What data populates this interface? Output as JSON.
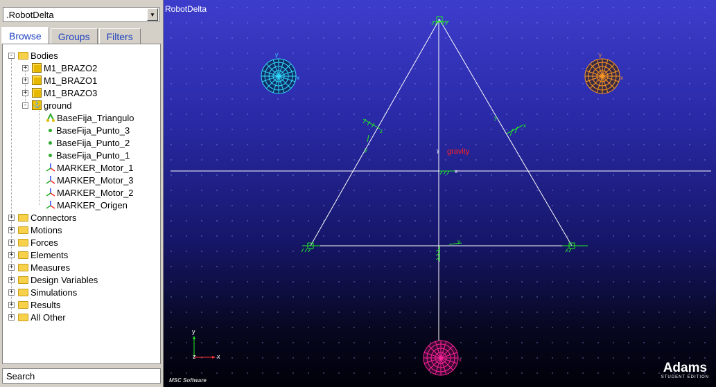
{
  "model_selector": {
    "value": ".RobotDelta"
  },
  "tabs": [
    {
      "label": "Browse",
      "active": true
    },
    {
      "label": "Groups",
      "active": false
    },
    {
      "label": "Filters",
      "active": false
    }
  ],
  "tree": {
    "bodies": {
      "label": "Bodies",
      "items": [
        "M1_BRAZO2",
        "M1_BRAZO1",
        "M1_BRAZO3"
      ],
      "ground": {
        "label": "ground",
        "children": [
          {
            "label": "BaseFija_Triangulo",
            "icon": "shape-icon"
          },
          {
            "label": "BaseFija_Punto_3",
            "icon": "point-icon"
          },
          {
            "label": "BaseFija_Punto_2",
            "icon": "point-icon"
          },
          {
            "label": "BaseFija_Punto_1",
            "icon": "point-icon"
          },
          {
            "label": "MARKER_Motor_1",
            "icon": "marker-icon"
          },
          {
            "label": "MARKER_Motor_3",
            "icon": "marker-icon"
          },
          {
            "label": "MARKER_Motor_2",
            "icon": "marker-icon"
          },
          {
            "label": "MARKER_Origen",
            "icon": "marker-icon"
          }
        ]
      }
    },
    "folders": [
      "Connectors",
      "Motions",
      "Forces",
      "Elements",
      "Measures",
      "Design Variables",
      "Simulations",
      "Results",
      "All Other"
    ]
  },
  "search": {
    "label": "Search"
  },
  "viewport": {
    "title": "RobotDelta",
    "gravity_label": "gravity",
    "axis_labels": {
      "x": "x",
      "y": "y",
      "z": "z"
    },
    "brand": "Adams",
    "brand_edition": "STUDENT EDITION",
    "footer": "MSC Software"
  },
  "colors": {
    "grid_line": "#ffffff",
    "marker": "#22ee22",
    "sphere_cyan": "#33ddff",
    "sphere_orange": "#ff9922",
    "sphere_magenta": "#ff2299",
    "gravity": "#ff2020"
  }
}
